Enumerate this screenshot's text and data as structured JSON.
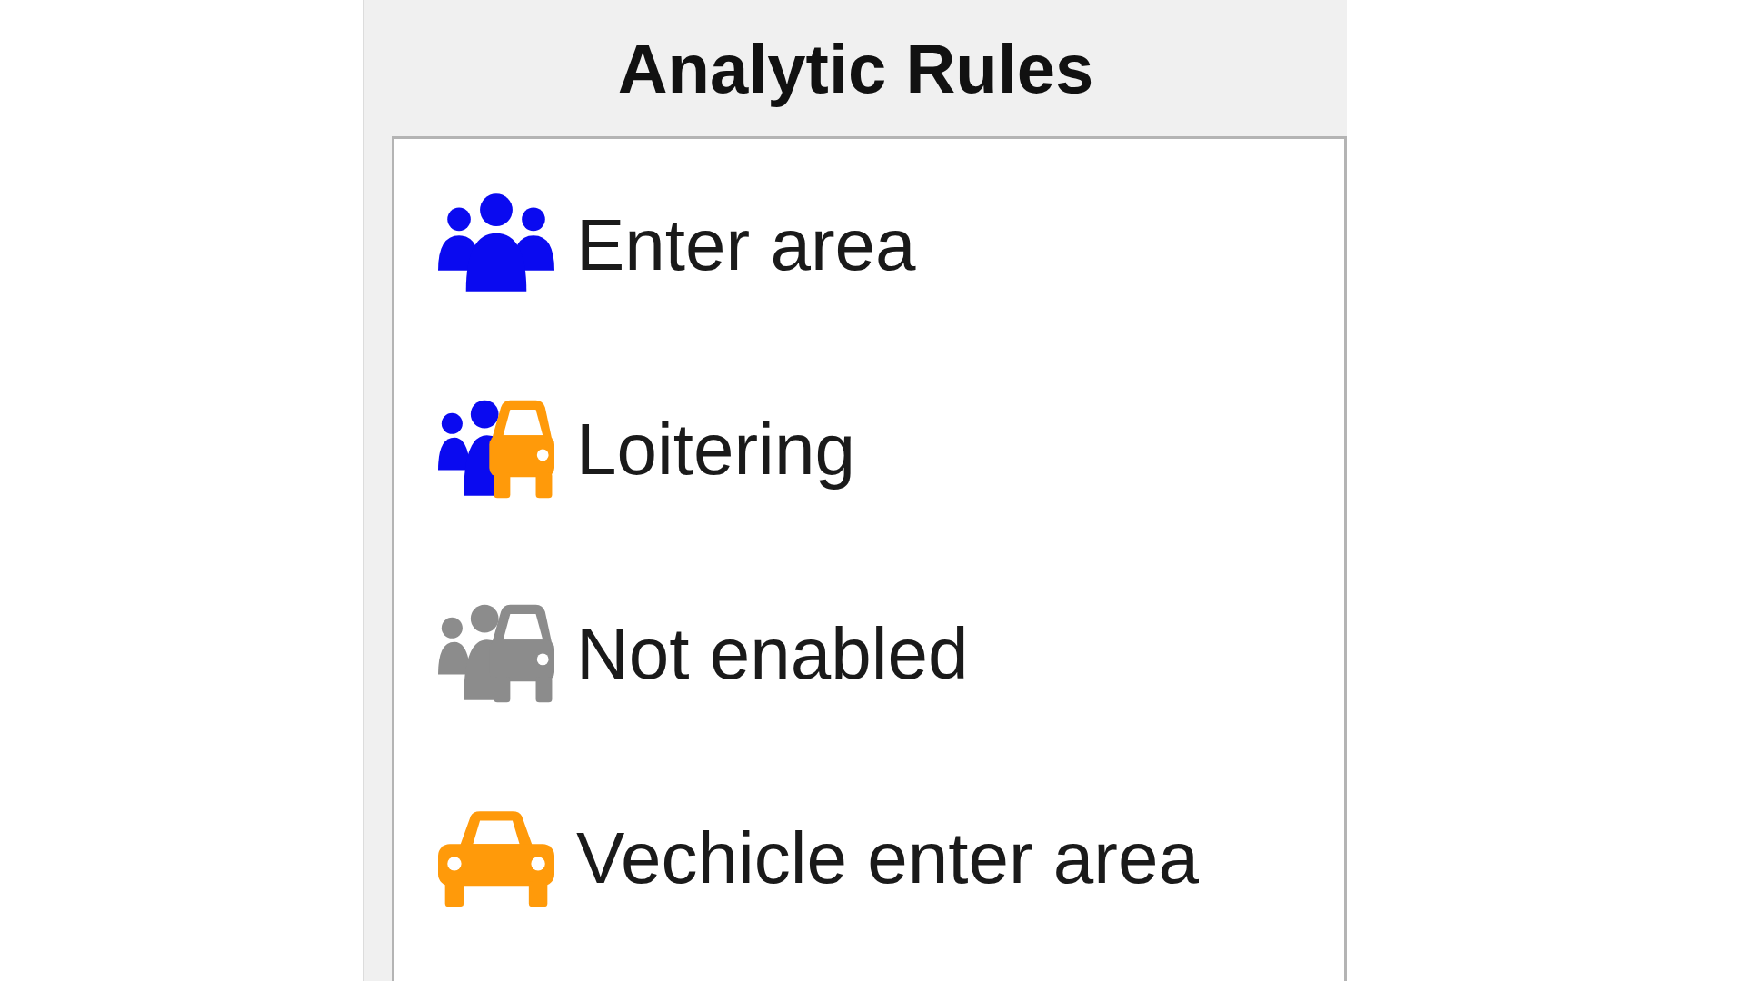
{
  "panel": {
    "title": "Analytic Rules"
  },
  "rules": [
    {
      "label": "Enter area",
      "kind": "people",
      "enabled": true
    },
    {
      "label": "Loitering",
      "kind": "people-vehicle",
      "enabled": true
    },
    {
      "label": "Not enabled",
      "kind": "people-vehicle",
      "enabled": false
    },
    {
      "label": "Vechicle enter area",
      "kind": "vehicle",
      "enabled": true
    }
  ]
}
